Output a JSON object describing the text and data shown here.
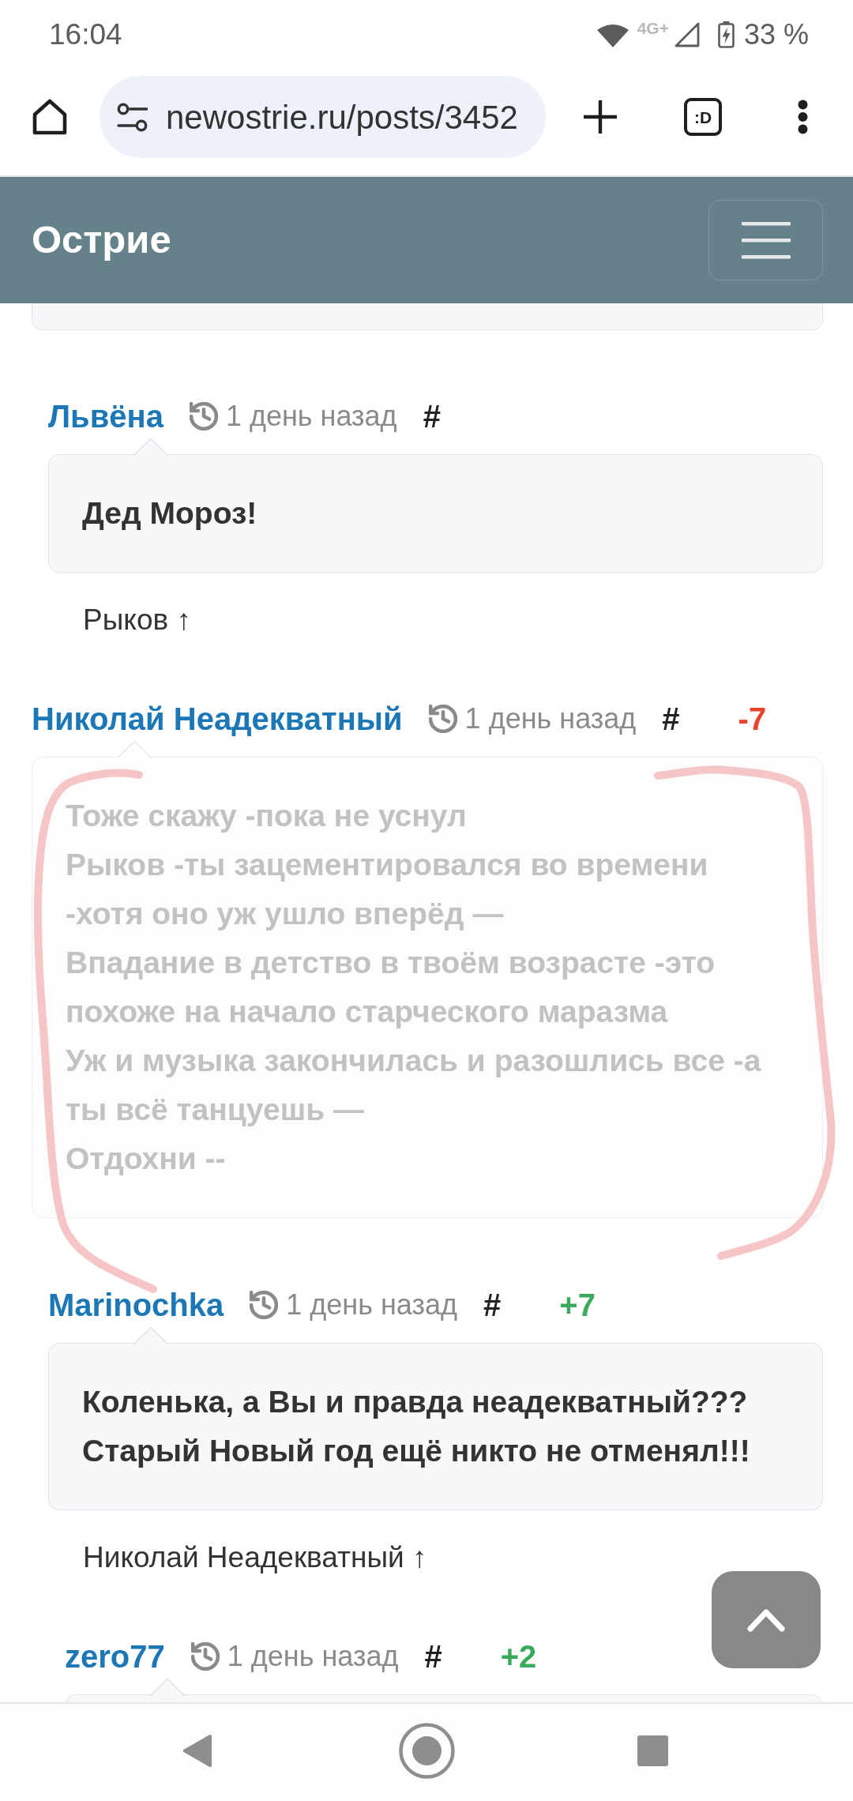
{
  "status_bar": {
    "time": "16:04",
    "network": "4G+",
    "battery": "33 %"
  },
  "browser": {
    "url": "newostrie.ru/posts/3452",
    "tab_switcher": ":D"
  },
  "header": {
    "title": "Острие"
  },
  "comments": [
    {
      "kind": "clipped",
      "children": [
        {
          "kind": "comment",
          "author": "Львёна",
          "time": "1 день назад",
          "anchor": "#",
          "dimmed": false,
          "body": [
            [
              "Дед Мороз!"
            ]
          ],
          "reply_to": "Рыков ↑"
        }
      ]
    },
    {
      "kind": "comment",
      "author": "Николай Неадекватный",
      "time": "1 день назад",
      "anchor": "#",
      "rating": {
        "text": "-7",
        "color": "#e8432b"
      },
      "dimmed": true,
      "body": [
        [
          "Тоже скажу -пока не уснул"
        ],
        [
          "Рыков -ты зацементировался во времени",
          "-хотя оно уж ушло вперёд —"
        ],
        [
          "Впадание в детство в твоём возрасте -это",
          "похоже на начало старческого маразма"
        ],
        [
          "Уж и музыка закончилась и разошлись все -а",
          "ты всё танцуешь —"
        ],
        [
          "Отдохни --"
        ]
      ],
      "children": [
        {
          "kind": "comment",
          "author": "Marinochka",
          "time": "1 день назад",
          "anchor": "#",
          "rating": {
            "text": "+7",
            "color": "#3caa5c"
          },
          "dimmed": false,
          "body": [
            [
              "Коленька, а Вы и правда неадекватный???",
              "Старый Новый год ещё никто не отменял!!!"
            ]
          ],
          "reply_to": "Николай Неадекватный ↑",
          "children": [
            {
              "kind": "comment",
              "author": "zero77",
              "time": "1 день назад",
              "anchor": "#",
              "rating": {
                "text": "+2",
                "color": "#3caa5c"
              },
              "dimmed": false
            }
          ]
        }
      ]
    }
  ]
}
